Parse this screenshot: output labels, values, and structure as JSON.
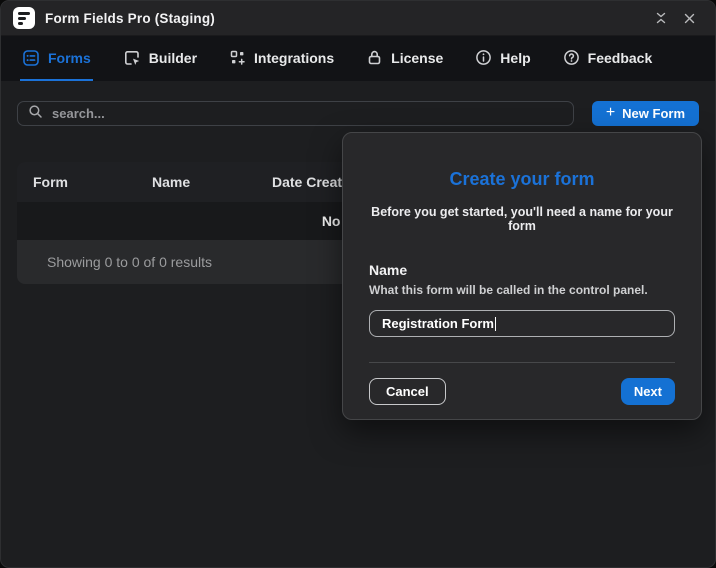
{
  "window": {
    "title": "Form Fields Pro (Staging)"
  },
  "nav": {
    "tabs": [
      {
        "label": "Forms",
        "active": true
      },
      {
        "label": "Builder",
        "active": false
      },
      {
        "label": "Integrations",
        "active": false
      },
      {
        "label": "License",
        "active": false
      },
      {
        "label": "Help",
        "active": false
      },
      {
        "label": "Feedback",
        "active": false
      }
    ]
  },
  "toolbar": {
    "search_placeholder": "search...",
    "new_form_plus": "+",
    "new_form_label": "New Form"
  },
  "table": {
    "columns": [
      "Form",
      "Name",
      "Date Created"
    ],
    "empty_text": "No results.",
    "footer_text": "Showing 0 to 0 of 0 results"
  },
  "modal": {
    "title": "Create your form",
    "subtitle": "Before you get started, you'll need a name for your form",
    "name_label": "Name",
    "name_description": "What this form will be called in the control panel.",
    "input_value": "Registration Form",
    "cancel_label": "Cancel",
    "next_label": "Next"
  },
  "colors": {
    "accent_blue": "#1471d3",
    "modal_bg": "#28282a",
    "nav_bg": "#121316"
  }
}
